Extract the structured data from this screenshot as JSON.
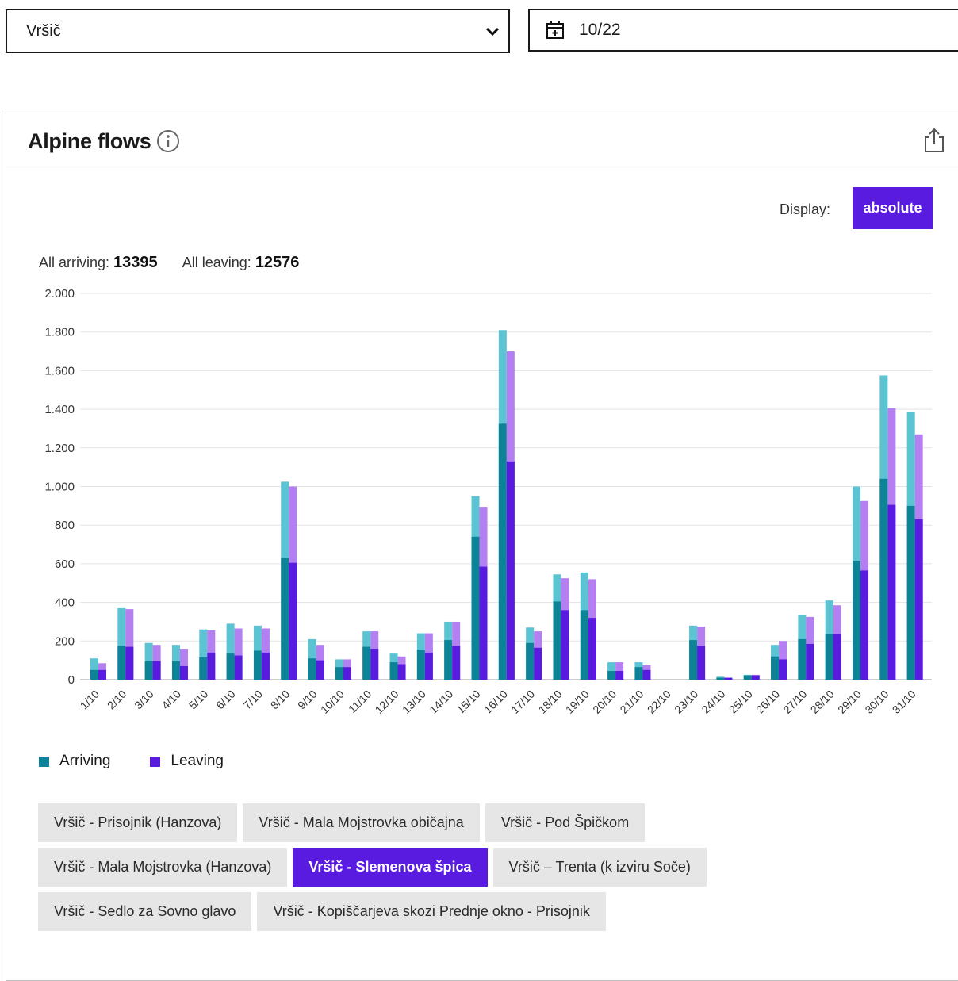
{
  "location_select": {
    "value": "Vršič"
  },
  "date_picker": {
    "value": "10/22"
  },
  "card": {
    "title": "Alpine flows",
    "display_label": "Display:",
    "display_value": "absolute"
  },
  "totals": {
    "arriving_label": "All arriving:",
    "arriving_value": "13395",
    "leaving_label": "All leaving:",
    "leaving_value": "12576"
  },
  "legend": {
    "arriving": "Arriving",
    "leaving": "Leaving"
  },
  "colors": {
    "arriving_dark": "#0c8397",
    "arriving_light": "#5bc3d2",
    "leaving_dark": "#5a1be0",
    "leaving_light": "#b47ff0"
  },
  "routes": [
    [
      "Vršič - Prisojnik (Hanzova)",
      "Vršič - Mala Mojstrovka običajna",
      "Vršič - Pod Špičkom"
    ],
    [
      "Vršič - Mala Mojstrovka (Hanzova)",
      "Vršič - Slemenova špica",
      "Vršič – Trenta (k izviru Soče)"
    ],
    [
      "Vršič - Sedlo za Sovno glavo",
      "Vršič - Kopiščarjeva skozi Prednje okno - Prisojnik"
    ]
  ],
  "active_route": "Vršič - Slemenova špica",
  "chart_data": {
    "type": "bar",
    "stacked": true,
    "categories": [
      "1/10",
      "2/10",
      "3/10",
      "4/10",
      "5/10",
      "6/10",
      "7/10",
      "8/10",
      "9/10",
      "10/10",
      "11/10",
      "12/10",
      "13/10",
      "14/10",
      "15/10",
      "16/10",
      "17/10",
      "18/10",
      "19/10",
      "20/10",
      "21/10",
      "22/10",
      "23/10",
      "24/10",
      "25/10",
      "26/10",
      "27/10",
      "28/10",
      "29/10",
      "30/10",
      "31/10"
    ],
    "y_ticks": [
      "0",
      "200",
      "400",
      "600",
      "800",
      "1.000",
      "1.200",
      "1.400",
      "1.600",
      "1.800",
      "2.000"
    ],
    "ylim": [
      0,
      2000
    ],
    "grid": true,
    "series": [
      {
        "name": "Arriving",
        "total": [
          110,
          370,
          190,
          180,
          260,
          290,
          280,
          1025,
          210,
          105,
          250,
          135,
          240,
          300,
          950,
          1810,
          270,
          545,
          555,
          90,
          90,
          0,
          280,
          15,
          25,
          180,
          335,
          410,
          1000,
          1575,
          1385
        ],
        "selected": [
          50,
          175,
          95,
          95,
          115,
          135,
          150,
          630,
          110,
          65,
          170,
          90,
          155,
          205,
          740,
          1325,
          190,
          405,
          360,
          45,
          65,
          0,
          205,
          10,
          22,
          120,
          210,
          235,
          615,
          1040,
          900
        ]
      },
      {
        "name": "Leaving",
        "total": [
          85,
          365,
          180,
          160,
          255,
          265,
          265,
          1000,
          180,
          105,
          250,
          120,
          240,
          300,
          895,
          1700,
          250,
          525,
          520,
          90,
          75,
          0,
          275,
          10,
          25,
          200,
          325,
          385,
          925,
          1405,
          1270
        ],
        "selected": [
          50,
          170,
          95,
          70,
          140,
          125,
          140,
          605,
          100,
          65,
          160,
          80,
          140,
          175,
          585,
          1130,
          165,
          360,
          320,
          45,
          50,
          0,
          175,
          10,
          22,
          105,
          185,
          235,
          565,
          905,
          830
        ]
      }
    ]
  }
}
